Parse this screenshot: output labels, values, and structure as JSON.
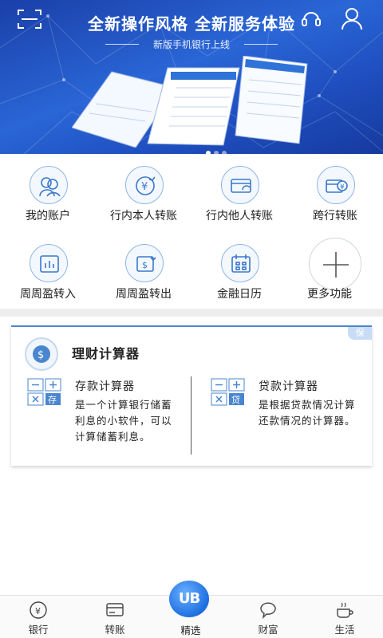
{
  "banner": {
    "title": "全新操作风格  全新服务体验",
    "subtitle": "新版手机银行上线",
    "slide_count": 3,
    "active_slide": 1
  },
  "functions": [
    {
      "label": "我的账户",
      "icon": "account-icon"
    },
    {
      "label": "行内本人转账",
      "icon": "self-transfer-icon"
    },
    {
      "label": "行内他人转账",
      "icon": "card-transfer-icon"
    },
    {
      "label": "跨行转账",
      "icon": "interbank-transfer-icon"
    },
    {
      "label": "周周盈转入",
      "icon": "fund-in-icon"
    },
    {
      "label": "周周盈转出",
      "icon": "fund-out-icon"
    },
    {
      "label": "金融日历",
      "icon": "calendar-icon"
    },
    {
      "label": "更多功能",
      "icon": "plus-icon"
    }
  ],
  "calculator": {
    "badge": "保",
    "title": "理财计算器",
    "deposit": {
      "title": "存款计算器",
      "desc": "是一个计算银行储蓄利息的小软件，可以计算储蓄利息。",
      "tag": "存"
    },
    "loan": {
      "title": "贷款计算器",
      "desc": "是根据贷款情况计算还款情况的计算器。",
      "tag": "贷"
    }
  },
  "nav": {
    "items": [
      {
        "label": "银行",
        "icon": "bank-icon"
      },
      {
        "label": "转账",
        "icon": "transfer-icon"
      },
      {
        "label": "精选",
        "icon": "ub-logo-icon",
        "logo_text": "UB"
      },
      {
        "label": "财富",
        "icon": "wealth-icon"
      },
      {
        "label": "生活",
        "icon": "life-icon"
      }
    ]
  },
  "colors": {
    "banner": "#2a66d6",
    "accent": "#4a86d0",
    "icon_stroke": "#3a78c9"
  }
}
